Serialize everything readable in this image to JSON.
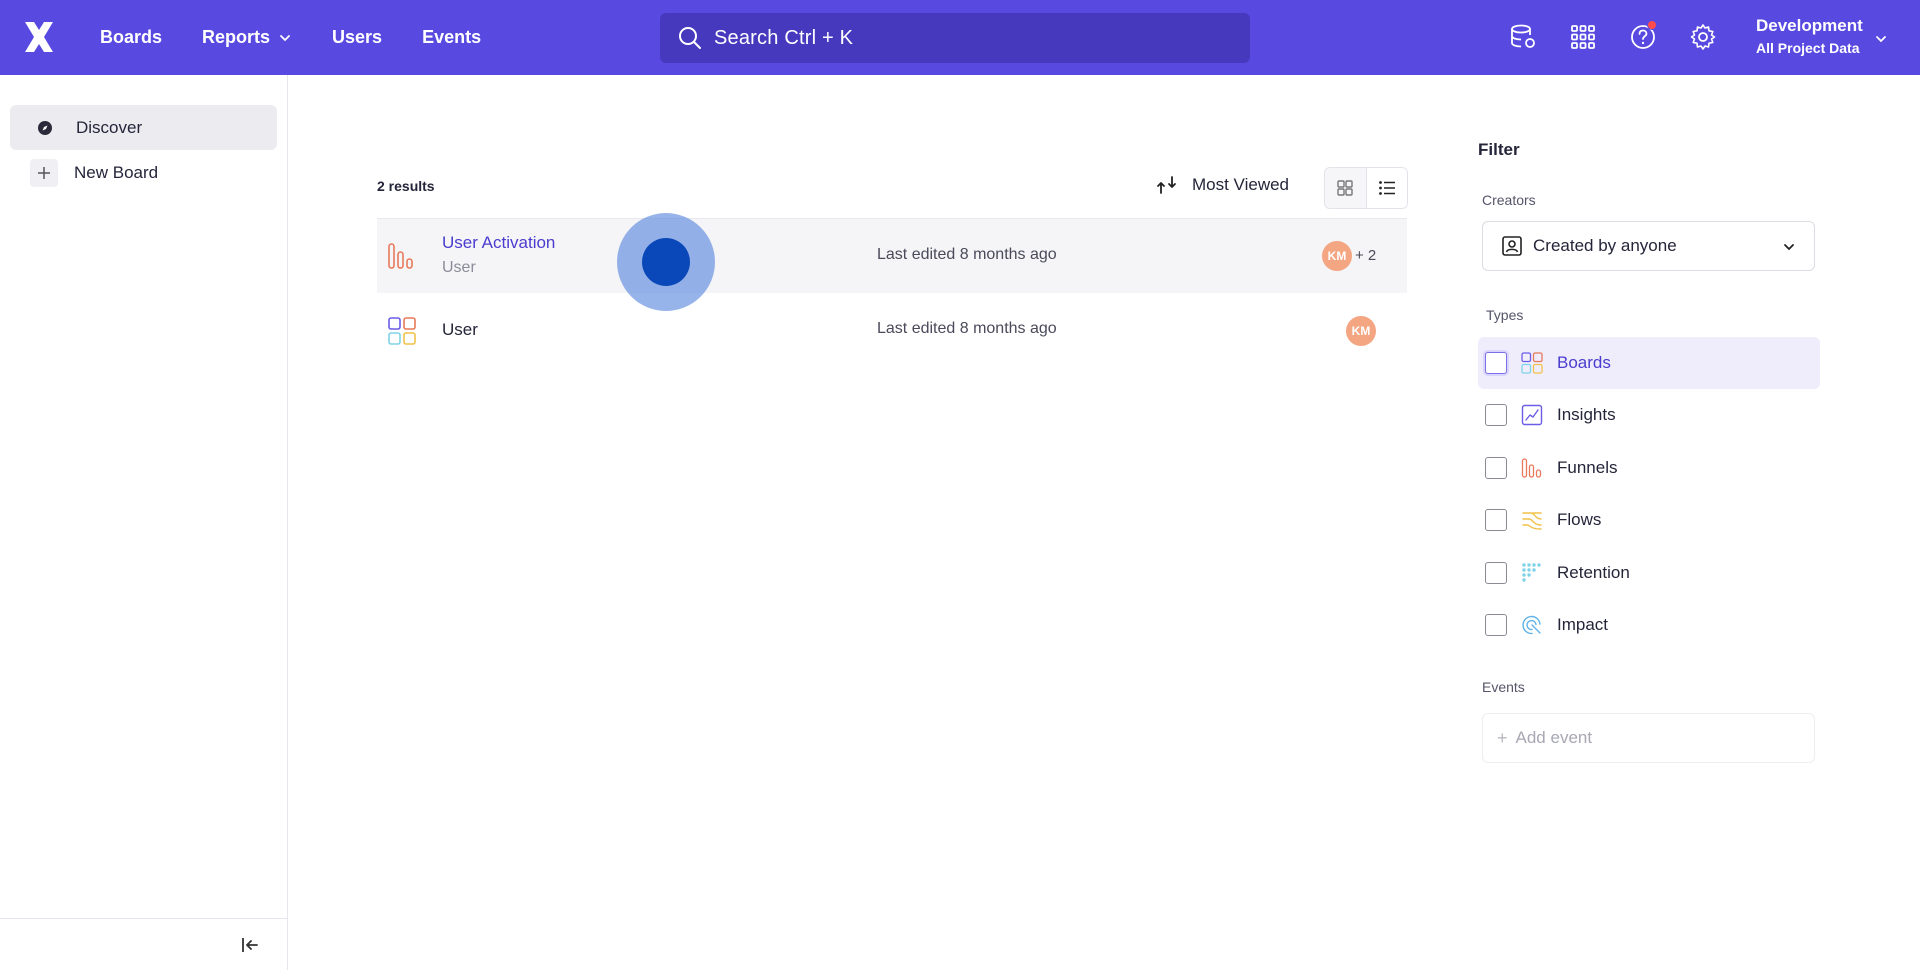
{
  "header": {
    "nav": [
      {
        "label": "Boards"
      },
      {
        "label": "Reports",
        "has_dropdown": true
      },
      {
        "label": "Users"
      },
      {
        "label": "Events"
      }
    ],
    "search": {
      "text": "Search  Ctrl + K"
    },
    "icons": [
      "database-settings-icon",
      "apps-grid-icon",
      "help-icon",
      "gear-icon"
    ],
    "project": {
      "name": "Development",
      "scope": "All Project Data"
    }
  },
  "sidebar": {
    "items": [
      {
        "label": "Discover",
        "icon": "compass-icon",
        "active": true
      },
      {
        "label": "New Board",
        "icon": "plus-icon",
        "active": false
      }
    ]
  },
  "main": {
    "results_count": "2 results",
    "sort_label": "Most Viewed",
    "rows": [
      {
        "title": "User Activation",
        "subtitle": "User",
        "edited": "Last edited 8 months ago",
        "avatar": "KM",
        "extra": "+ 2",
        "type": "funnel"
      },
      {
        "title": "User",
        "subtitle": "",
        "edited": "Last edited 8 months ago",
        "avatar": "KM",
        "extra": "",
        "type": "board"
      }
    ]
  },
  "filter": {
    "title": "Filter",
    "creators_label": "Creators",
    "creators_value": "Created by anyone",
    "types_label": "Types",
    "types": [
      {
        "label": "Boards",
        "highlight": true
      },
      {
        "label": "Insights"
      },
      {
        "label": "Funnels"
      },
      {
        "label": "Flows"
      },
      {
        "label": "Retention"
      },
      {
        "label": "Impact"
      }
    ],
    "events_label": "Events",
    "add_event_placeholder": "Add event"
  },
  "colors": {
    "brand": "#5849e0",
    "search_bg": "#4639bd",
    "accent_text": "#4a3ccf",
    "avatar": "#f4a582"
  }
}
